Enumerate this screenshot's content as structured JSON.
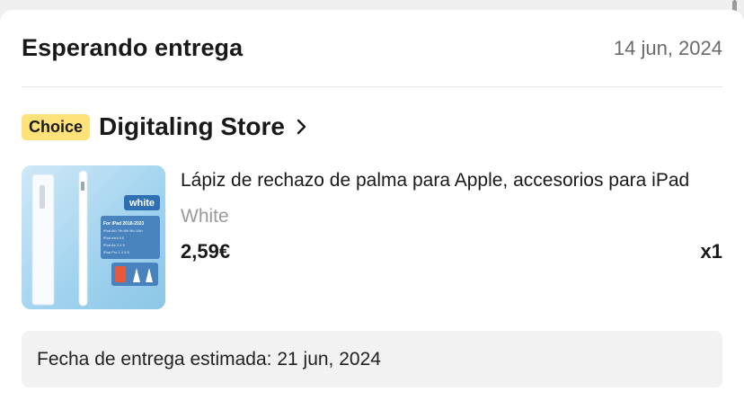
{
  "order": {
    "status_title": "Esperando entrega",
    "date": "14 jun, 2024"
  },
  "store": {
    "badge": "Choice",
    "name": "Digitaling Store",
    "chevron_icon": "chevron-right-icon"
  },
  "product": {
    "title": "Lápiz de rechazo de palma para Apple, accesorios para iPad",
    "variant": "White",
    "price": "2,59€",
    "quantity": "x1",
    "thumbnail": {
      "tag": "white",
      "compat_heading": "For iPad 2018-2023",
      "compat_lines": [
        "iPad 6th 7th 8th 9th 10th",
        "iPad mini 5 6",
        "iPad Air 3 4 5",
        "iPad Pro 1 4 5 6"
      ]
    }
  },
  "delivery": {
    "estimate_text": "Fecha de entrega estimada: 21 jun, 2024"
  },
  "colors": {
    "badge_bg": "#ffe27a",
    "thumb_bg": "#9fd2ee",
    "muted_text": "#9a9a9a"
  }
}
